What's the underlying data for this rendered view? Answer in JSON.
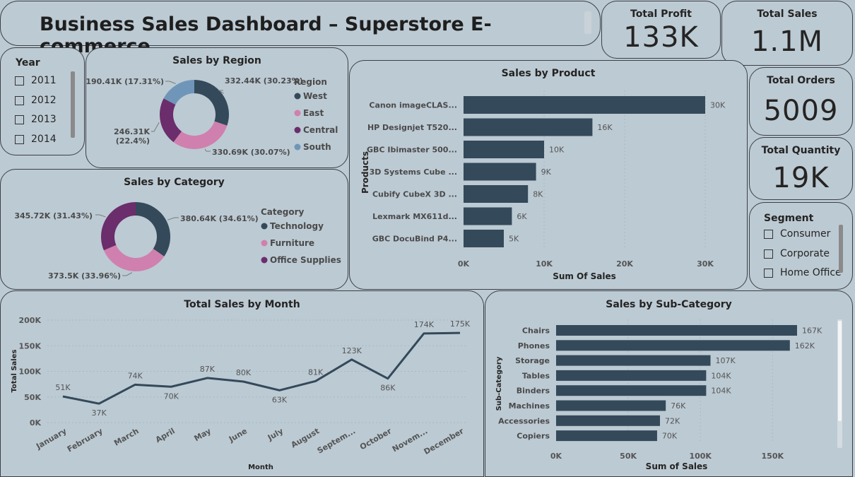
{
  "title": "Business Sales Dashboard – Superstore E-commerce",
  "kpis": {
    "profit": {
      "label": "Total Profit",
      "value": "133K"
    },
    "sales": {
      "label": "Total Sales",
      "value": "1.1M"
    },
    "orders": {
      "label": "Total Orders",
      "value": "5009"
    },
    "quantity": {
      "label": "Total Quantity",
      "value": "19K"
    }
  },
  "year_slicer": {
    "title": "Year",
    "items": [
      "2011",
      "2012",
      "2013",
      "2014"
    ]
  },
  "segment_slicer": {
    "title": "Segment",
    "items": [
      "Consumer",
      "Corporate",
      "Home Office"
    ]
  },
  "colors": {
    "bar": "#34495a",
    "west": "#34495a",
    "east": "#d080ae",
    "central": "#6b2d6b",
    "south": "#6f96b8",
    "grid": "#a9b8c2"
  },
  "chart_data": [
    {
      "id": "region",
      "type": "pie",
      "title": "Sales by Region",
      "legend_title": "Region",
      "legend_position": "right",
      "slices": [
        {
          "name": "West",
          "value": 332.44,
          "label": "332.44K (30.23%)",
          "color": "#34495a"
        },
        {
          "name": "East",
          "value": 330.69,
          "label": "330.69K (30.07%)",
          "color": "#d080ae"
        },
        {
          "name": "Central",
          "value": 246.31,
          "label": "246.31K (22.4%)",
          "color": "#6b2d6b"
        },
        {
          "name": "South",
          "value": 190.41,
          "label": "190.41K (17.31%)",
          "color": "#6f96b8"
        }
      ]
    },
    {
      "id": "category",
      "type": "pie",
      "title": "Sales by Category",
      "legend_title": "Category",
      "legend_position": "right",
      "slices": [
        {
          "name": "Technology",
          "value": 380.64,
          "label": "380.64K (34.61%)",
          "color": "#34495a"
        },
        {
          "name": "Furniture",
          "value": 373.5,
          "label": "373.5K (33.96%)",
          "color": "#d080ae"
        },
        {
          "name": "Office Supplies",
          "value": 345.72,
          "label": "345.72K (31.43%)",
          "color": "#6b2d6b"
        }
      ]
    },
    {
      "id": "product",
      "type": "bar",
      "orientation": "horizontal",
      "title": "Sales by Product",
      "xlabel": "Sum Of Sales",
      "ylabel": "Products",
      "categories": [
        "Canon imageCLAS...",
        "HP Designjet T520...",
        "GBC Ibimaster 500...",
        "3D Systems Cube ...",
        "Cubify CubeX 3D ...",
        "Lexmark MX611d...",
        "GBC DocuBind P4..."
      ],
      "values": [
        30000,
        16000,
        10000,
        9000,
        8000,
        6000,
        5000
      ],
      "data_labels": [
        "30K",
        "16K",
        "10K",
        "9K",
        "8K",
        "6K",
        "5K"
      ],
      "xlim": [
        0,
        30000
      ],
      "ticks": [
        "0K",
        "10K",
        "20K",
        "30K"
      ],
      "grid": true
    },
    {
      "id": "month",
      "type": "line",
      "title": "Total Sales by Month",
      "xlabel": "Month",
      "ylabel": "Total Sales",
      "categories": [
        "January",
        "February",
        "March",
        "April",
        "May",
        "June",
        "July",
        "August",
        "Septem...",
        "October",
        "Novem...",
        "December"
      ],
      "values": [
        51000,
        37000,
        74000,
        70000,
        87000,
        80000,
        63000,
        81000,
        123000,
        86000,
        174000,
        175000
      ],
      "data_labels": [
        "51K",
        "37K",
        "74K",
        "70K",
        "87K",
        "80K",
        "63K",
        "81K",
        "123K",
        "86K",
        "174K",
        "175K"
      ],
      "ylim": [
        0,
        200000
      ],
      "ticks": [
        "0K",
        "50K",
        "100K",
        "150K",
        "200K"
      ],
      "grid": true
    },
    {
      "id": "subcategory",
      "type": "bar",
      "orientation": "horizontal",
      "title": "Sales by Sub-Category",
      "xlabel": "Sum of Sales",
      "ylabel": "Sub-Category",
      "categories": [
        "Chairs",
        "Phones",
        "Storage",
        "Tables",
        "Binders",
        "Machines",
        "Accessories",
        "Copiers"
      ],
      "values": [
        167000,
        162000,
        107000,
        104000,
        104000,
        76000,
        72000,
        70000
      ],
      "data_labels": [
        "167K",
        "162K",
        "107K",
        "104K",
        "104K",
        "76K",
        "72K",
        "70K"
      ],
      "xlim": [
        0,
        167000
      ],
      "ticks": [
        "0K",
        "50K",
        "100K",
        "150K"
      ],
      "grid": true
    }
  ]
}
